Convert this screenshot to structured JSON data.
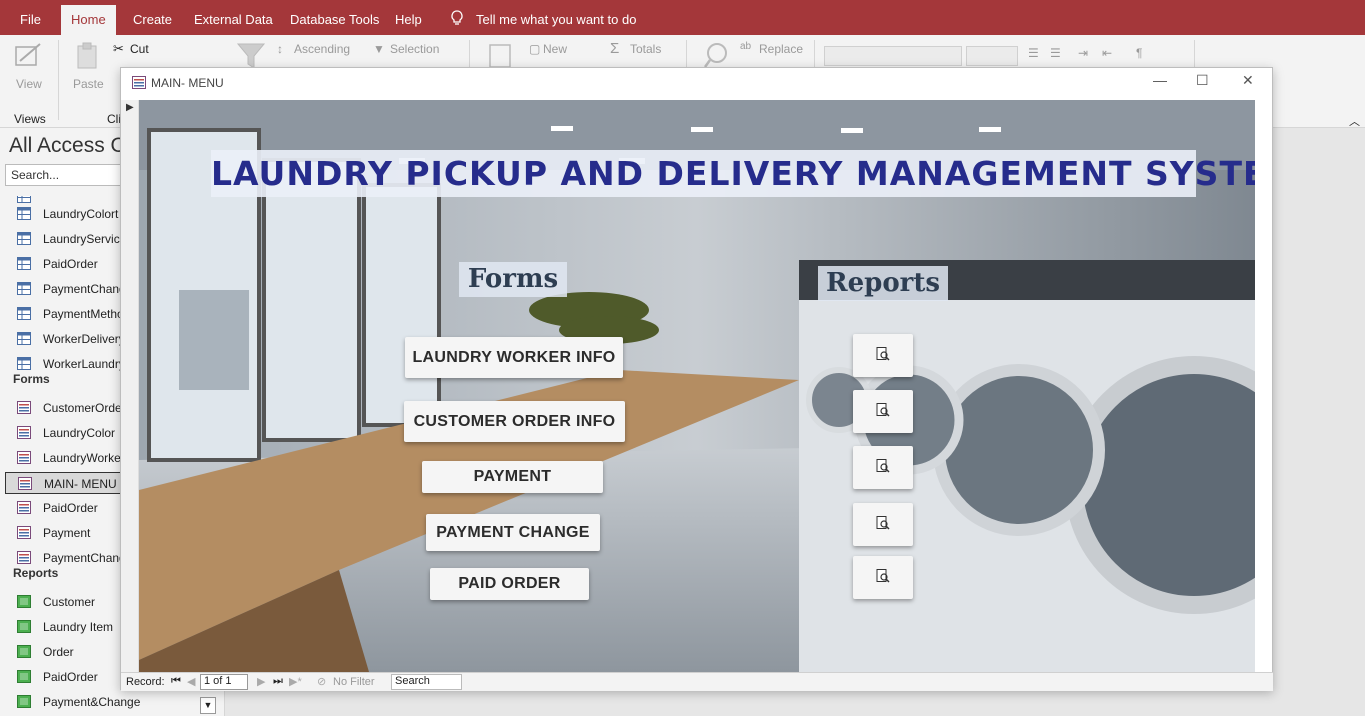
{
  "ribbon": {
    "tabs": [
      "File",
      "Home",
      "Create",
      "External Data",
      "Database Tools",
      "Help"
    ],
    "active_tab": "Home",
    "tell_me": "Tell me what you want to do",
    "view_label": "View",
    "views_group": "Views",
    "paste_label": "Paste",
    "clipboard_group_partial": "Cli",
    "cut_label": "Cut",
    "ascending_label": "Ascending",
    "selection_label": "Selection",
    "new_label": "New",
    "totals_label": "Totals",
    "replace_label": "Replace"
  },
  "nav": {
    "title": "All Access O",
    "search_placeholder": "Search...",
    "table_items": [
      "LaundryColort",
      "LaundryService",
      "PaidOrder",
      "PaymentChang",
      "PaymentMetho",
      "WorkerDelivery",
      "WorkerLaundry"
    ],
    "forms_header": "Forms",
    "form_items": [
      "CustomerOrde",
      "LaundryColor",
      "LaundryWorke",
      "MAIN- MENU",
      "PaidOrder",
      "Payment",
      "PaymentChang"
    ],
    "selected_form": "MAIN- MENU",
    "reports_header": "Reports",
    "report_items": [
      "Customer",
      "Laundry Item",
      "Order",
      "PaidOrder",
      "Payment&Change"
    ]
  },
  "window": {
    "title": "MAIN- MENU",
    "minimize": "—",
    "maximize": "☐",
    "close": "✕"
  },
  "form": {
    "title": "LAUNDRY PICKUP AND DELIVERY MANAGEMENT SYSTEM",
    "forms_label": "Forms",
    "reports_label": "Reports",
    "buttons": [
      "LAUNDRY WORKER INFO",
      "CUSTOMER ORDER INFO",
      "PAYMENT",
      "PAYMENT CHANGE",
      "PAID ORDER"
    ],
    "report_buttons": [
      "report-preview-1",
      "report-preview-2",
      "report-preview-3",
      "report-preview-4",
      "report-preview-5"
    ]
  },
  "record_nav": {
    "label": "Record:",
    "position": "1 of 1",
    "filter": "No Filter",
    "search": "Search"
  },
  "colors": {
    "accent": "#a4373a",
    "title_text": "#262c8c",
    "button_face": "#f5f5f5"
  }
}
